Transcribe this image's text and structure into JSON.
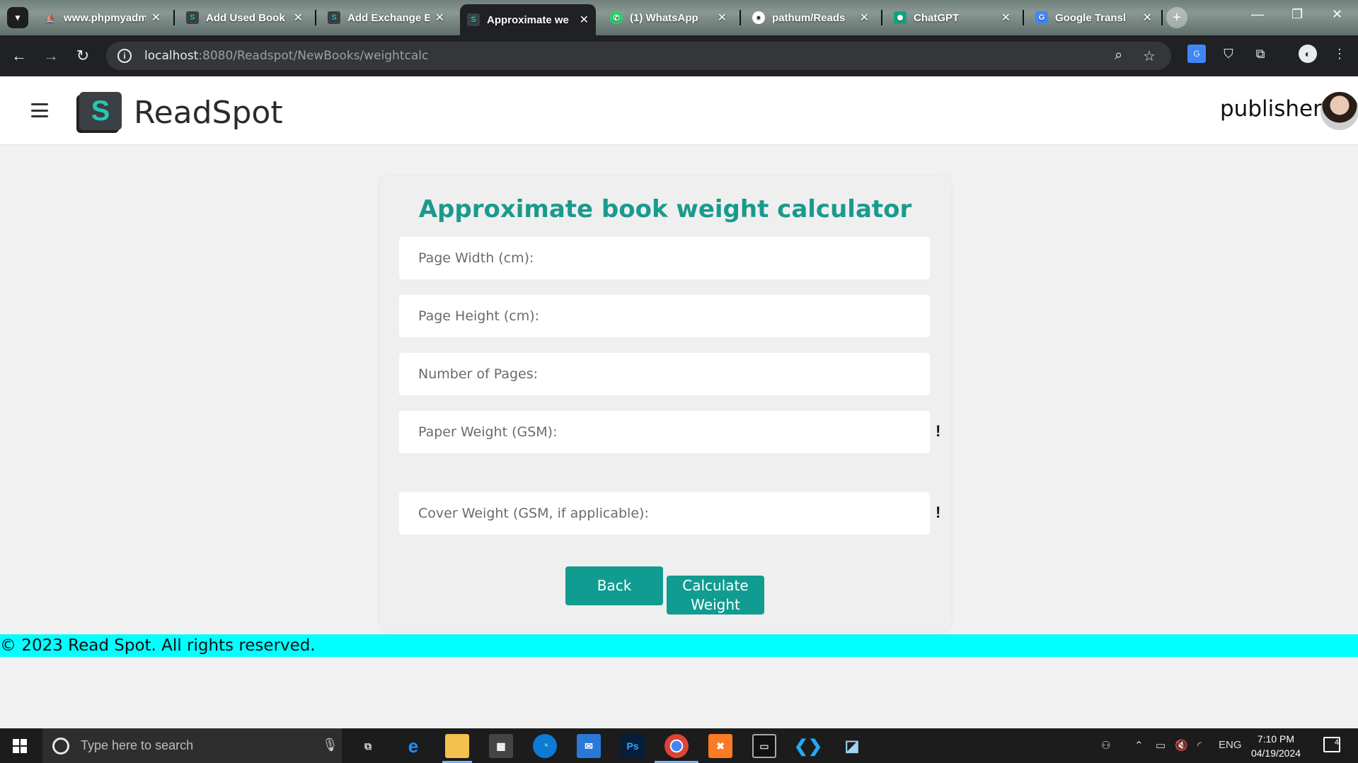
{
  "browser": {
    "tabs": [
      {
        "label": "www.phpmyadm",
        "favicon": "phpmyadmin-icon",
        "color": "#f29111"
      },
      {
        "label": "Add Used Book",
        "favicon": "readspot-icon",
        "color": "#3b4044"
      },
      {
        "label": "Add Exchange B",
        "favicon": "readspot-icon",
        "color": "#3b4044"
      },
      {
        "label": "Approximate we",
        "favicon": "readspot-icon",
        "color": "#3b4044"
      },
      {
        "label": "(1) WhatsApp",
        "favicon": "whatsapp-icon",
        "color": "#25d366"
      },
      {
        "label": "pathum/Reads",
        "favicon": "github-icon",
        "color": "#333333"
      },
      {
        "label": "ChatGPT",
        "favicon": "chatgpt-icon",
        "color": "#10a37f"
      },
      {
        "label": "Google Transl",
        "favicon": "google-translate-icon",
        "color": "#4285f4"
      }
    ],
    "url_host": "localhost",
    "url_rest": ":8080/Readspot/NewBooks/weightcalc"
  },
  "header": {
    "brand": "ReadSpot",
    "logo_letter": "S",
    "user_name": "publisher"
  },
  "form": {
    "title": "Approximate book weight calculator",
    "page_width_placeholder": "Page Width (cm):",
    "page_height_placeholder": "Page Height (cm):",
    "pages_placeholder": "Number of Pages:",
    "paper_weight_placeholder": "Paper Weight (GSM):",
    "cover_weight_placeholder": "Cover Weight (GSM, if applicable):",
    "warning_mark": "!",
    "back_label": "Back",
    "calculate_label": "Calculate Weight"
  },
  "footer": {
    "copyright": "© 2023 Read Spot. All rights reserved."
  },
  "taskbar": {
    "search_placeholder": "Type here to search",
    "language": "ENG",
    "time": "7:10 PM",
    "date": "04/19/2024",
    "notification_count": "4"
  },
  "colors": {
    "accent": "#1a9a8d",
    "button": "#109c90",
    "footer": "#00ffff"
  }
}
